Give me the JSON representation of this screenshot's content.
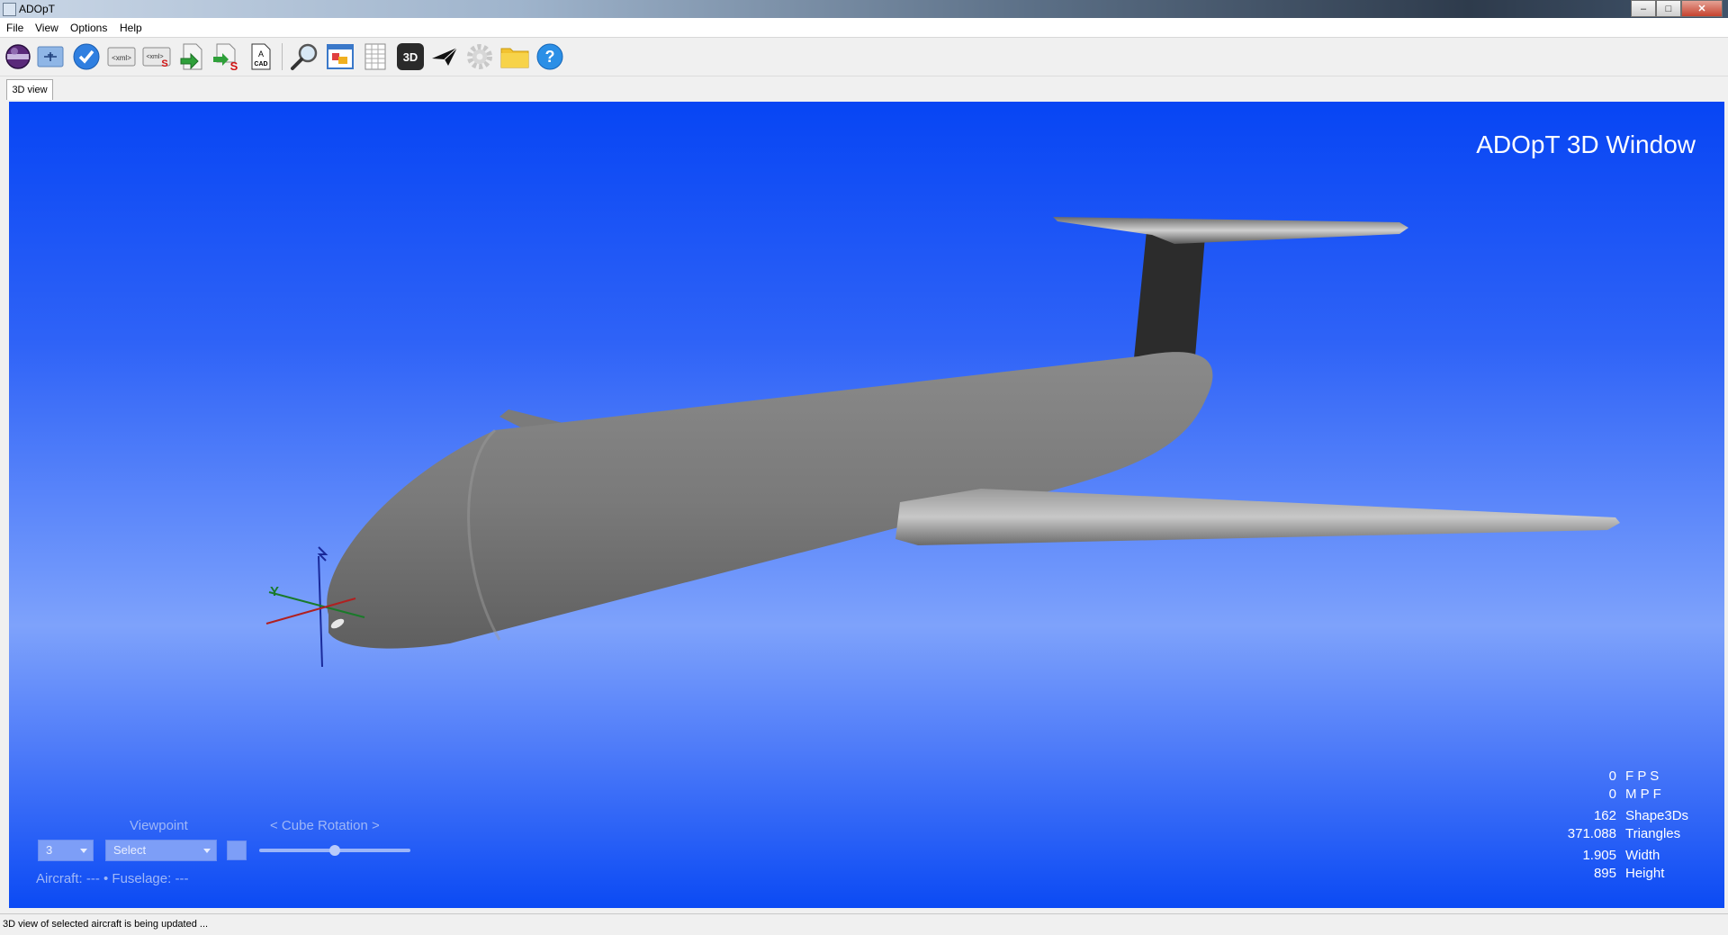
{
  "window": {
    "title": "ADOpT"
  },
  "menu": {
    "items": [
      "File",
      "View",
      "Options",
      "Help"
    ]
  },
  "toolbar": {
    "buttons": [
      "aircraft-sphere-icon",
      "airplane-icon",
      "check-icon",
      "xml-icon",
      "xml-save-icon",
      "export-icon",
      "save-s-icon",
      "cad-icon",
      "magnifier-icon",
      "window-icon",
      "grid-icon",
      "3d-icon",
      "paper-plane-icon",
      "gear-icon",
      "folder-icon",
      "help-icon"
    ],
    "xml_label": "<xml>",
    "cad_label": "CAD",
    "threed_label": "3D",
    "help_label": "?"
  },
  "tabs": [
    {
      "label": "3D view"
    }
  ],
  "viewport": {
    "title": "ADOpT 3D Window",
    "stats": [
      {
        "value": "0",
        "label": "F P S"
      },
      {
        "value": "0",
        "label": "M P F"
      },
      {
        "value": "162",
        "label": "Shape3Ds"
      },
      {
        "value": "371.088",
        "label": "Triangles"
      },
      {
        "value": "1.905",
        "label": "Width"
      },
      {
        "value": "895",
        "label": "Height"
      }
    ],
    "axis_label": "Y",
    "controls": {
      "viewpoint_label": "Viewpoint",
      "cube_rotation_label": "<  Cube Rotation  >",
      "level_select_value": "3",
      "viewpoint_select_value": "Select",
      "cube_rotation_value": 0.5,
      "info_line": "Aircraft: ---   • Fuselage: ---"
    },
    "colors": {
      "sky_top": "#0745f4",
      "sky_mid": "#7ea2fb",
      "aircraft_gray": "#7d7d7d",
      "tail_dark": "#2c2c2c"
    }
  },
  "status": {
    "text": "3D view of selected aircraft is being updated ..."
  }
}
